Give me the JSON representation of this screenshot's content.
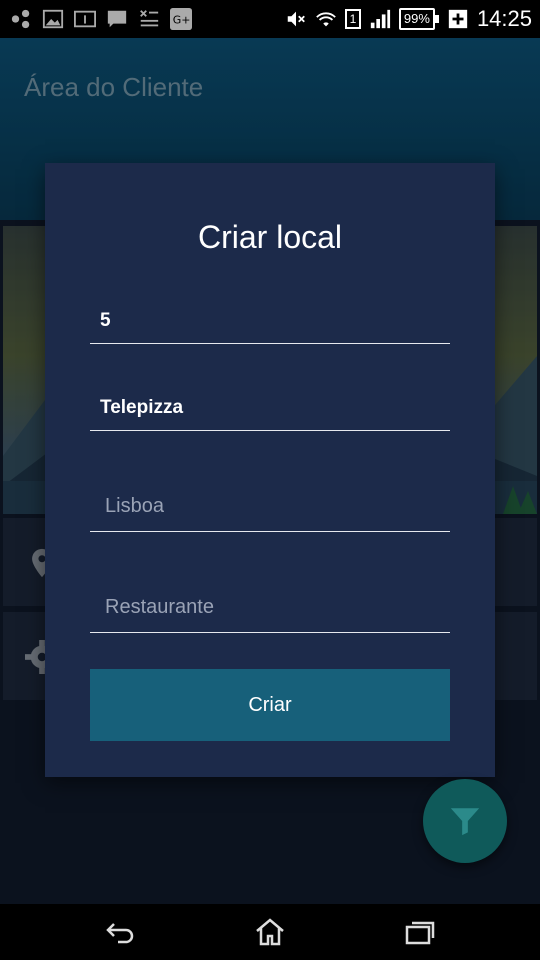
{
  "status_bar": {
    "battery_percent": "99%",
    "sim_slot": "1",
    "time": "14:25",
    "notification_icons": [
      "share-icon",
      "image-icon",
      "info-icon",
      "message-icon",
      "sim-toolkit-icon",
      "google-plus-icon"
    ],
    "system_icons": [
      "mute-icon",
      "wifi-icon",
      "sim-icon",
      "signal-icon",
      "battery-icon",
      "charging-icon"
    ]
  },
  "app_bar": {
    "title": "Área do Cliente"
  },
  "dialog": {
    "title": "Criar local",
    "fields": {
      "number": {
        "value": "5"
      },
      "name": {
        "value": "Telepizza"
      },
      "city": {
        "value": "",
        "placeholder": "Lisboa"
      },
      "category": {
        "value": "",
        "placeholder": "Restaurante"
      }
    },
    "button_label": "Criar"
  },
  "background_list": {
    "icons": [
      "location-pin-icon",
      "settings-gear-icon"
    ]
  },
  "fab": {
    "icon": "filter-funnel-icon"
  },
  "nav_bar": {
    "icons": [
      "back-icon",
      "home-icon",
      "recent-apps-icon"
    ]
  },
  "colors": {
    "dialog_bg": "#1c2a4a",
    "button_bg": "#17607a",
    "app_bar_bg": "#0b4d70",
    "fab_bg": "#0f5a5a"
  }
}
